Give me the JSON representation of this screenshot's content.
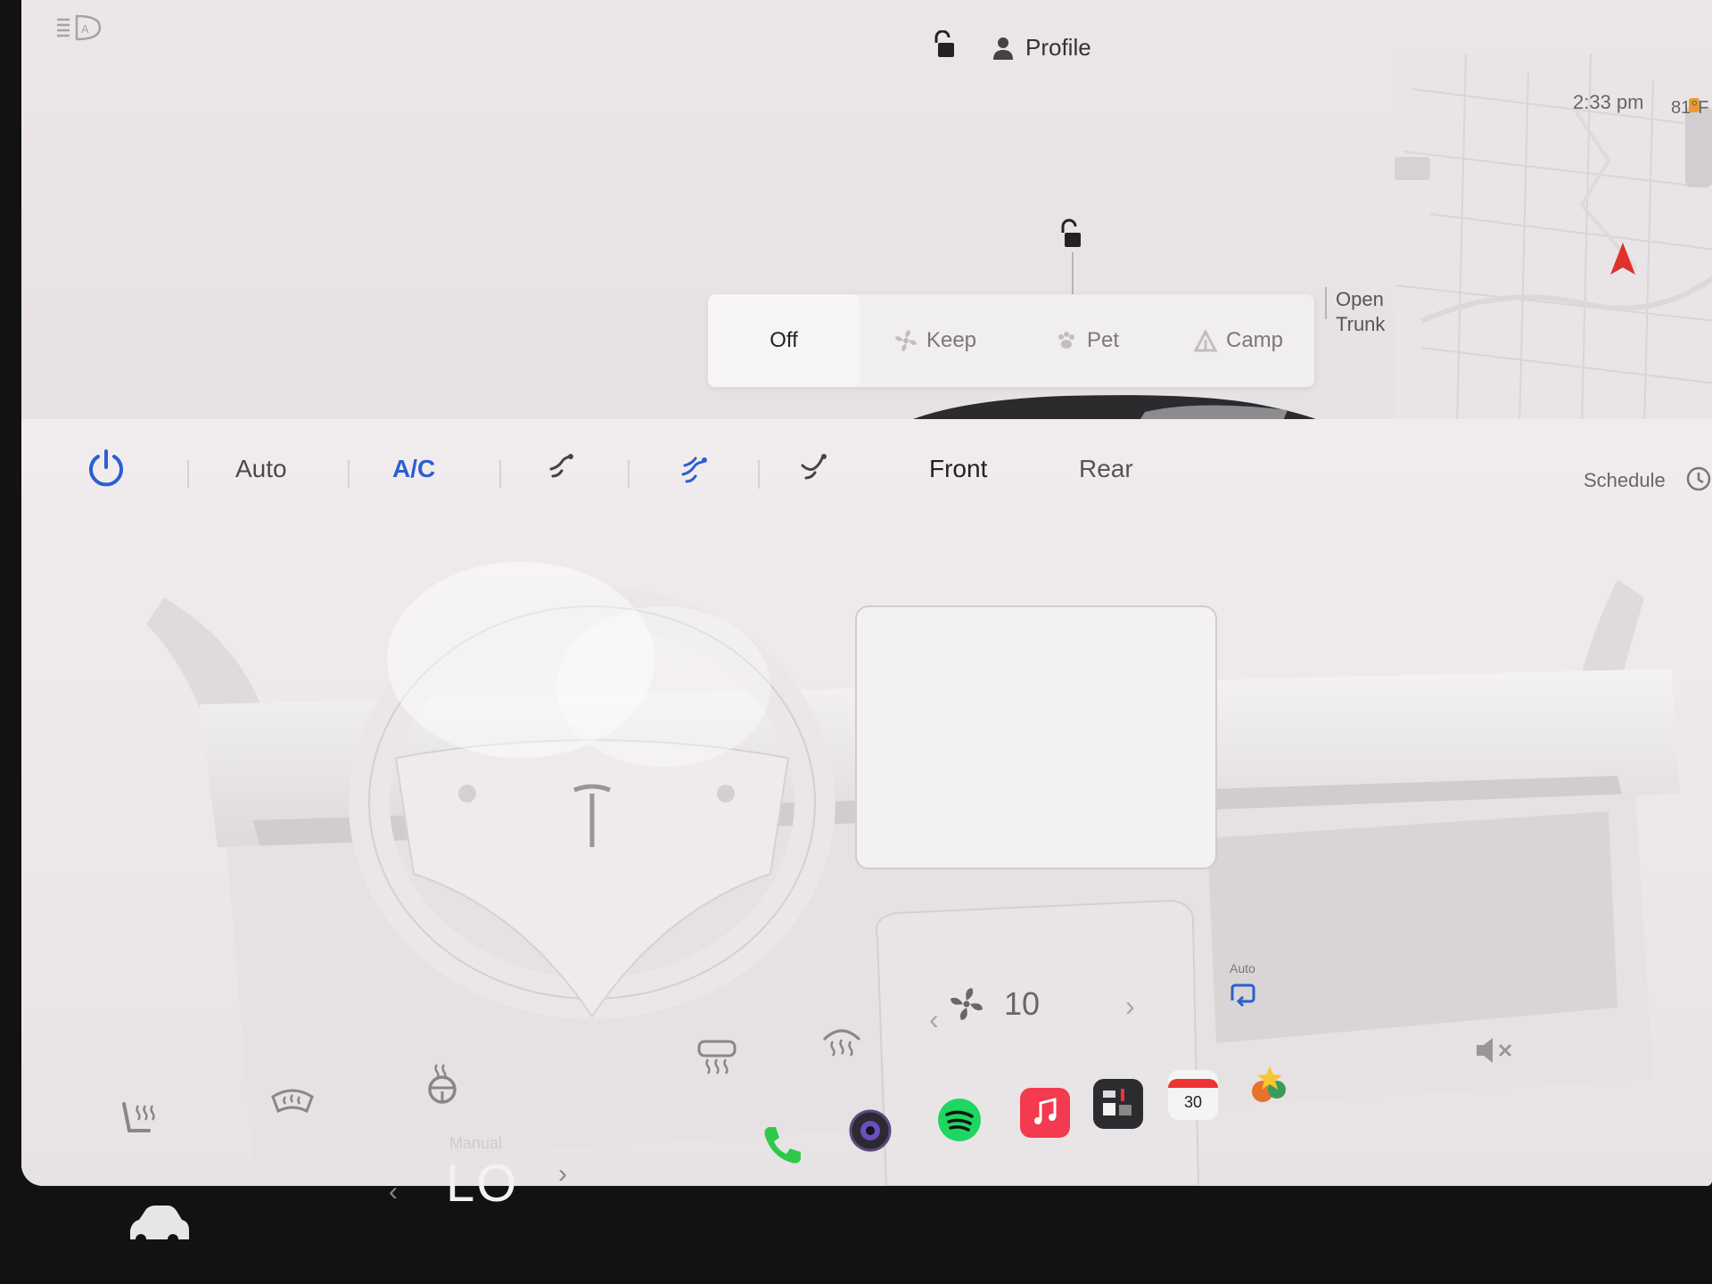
{
  "status_bar": {
    "profile_label": "Profile",
    "time": "2:33 pm",
    "outside_temp": "81°F"
  },
  "car": {
    "open_trunk_label": "Open Trunk"
  },
  "climate_modes": [
    {
      "label": "Off",
      "icon": "none",
      "active": true
    },
    {
      "label": "Keep",
      "icon": "fan-icon",
      "active": false
    },
    {
      "label": "Pet",
      "icon": "paw-icon",
      "active": false
    },
    {
      "label": "Camp",
      "icon": "tent-icon",
      "active": false
    }
  ],
  "climate_bar": {
    "power_icon": "power-icon",
    "auto_label": "Auto",
    "ac_label": "A/C",
    "airflow_icons": [
      "airflow-face-icon",
      "airflow-face-feet-icon",
      "airflow-feet-icon"
    ],
    "active_airflow": "airflow-face-feet-icon",
    "front_label": "Front",
    "rear_label": "Rear",
    "schedule_label": "Schedule",
    "accent_color": "#2b5fd0"
  },
  "climate_bottom": {
    "fan_speed": "10",
    "recirc_label": "Auto",
    "icons": [
      "seat-heater-icon",
      "windshield-defrost-icon",
      "steering-wheel-heater-icon",
      "rear-defrost-icon",
      "front-defrost-icon",
      "recirculate-icon",
      "mute-icon"
    ]
  },
  "dock": {
    "temp_mode_label": "Manual",
    "temp_value": "LO",
    "calendar_day": "30",
    "apps": [
      "phone-icon",
      "camera-icon",
      "spotify-icon",
      "music-icon",
      "toybox-icon",
      "calendar-icon",
      "games-icon"
    ]
  }
}
